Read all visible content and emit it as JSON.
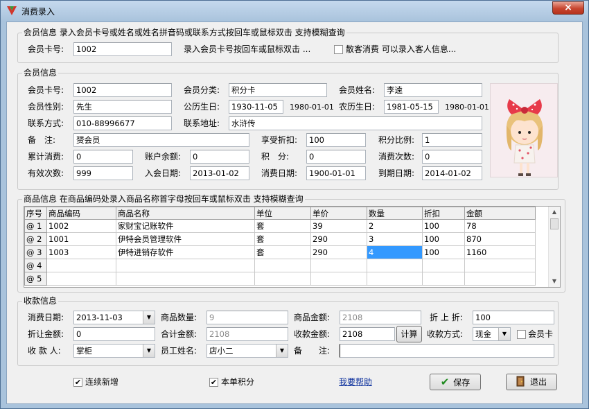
{
  "window": {
    "title": "消费录入",
    "close_glyph": "×"
  },
  "member_search": {
    "group_title": "会员信息 录入会员卡号或姓名或姓名拼音码或联系方式按回车或鼠标双击 支持模糊查询",
    "card_label": "会员卡号:",
    "card_value": "1002",
    "hint": "录入会员卡号按回车或鼠标双击 ...",
    "guest_checkbox_label": "散客消费 可以录入客人信息...",
    "guest_checked": false
  },
  "member_info": {
    "group_title": "会员信息",
    "card_no": {
      "label": "会员卡号:",
      "value": "1002"
    },
    "category": {
      "label": "会员分类:",
      "value": "积分卡"
    },
    "name": {
      "label": "会员姓名:",
      "value": "李逵"
    },
    "gender": {
      "label": "会员性别:",
      "value": "先生"
    },
    "solar_birthday": {
      "label": "公历生日:",
      "value": "1930-11-05",
      "extra": "1980-01-01"
    },
    "lunar_birthday": {
      "label": "农历生日:",
      "value": "1981-05-15",
      "extra": "1980-01-01"
    },
    "contact": {
      "label": "联系方式:",
      "value": "010-88996677"
    },
    "address": {
      "label": "联系地址:",
      "value": "水浒传"
    },
    "remark": {
      "label": "备　注:",
      "value": "赟会员"
    },
    "discount": {
      "label": "享受折扣:",
      "value": "100"
    },
    "points_ratio": {
      "label": "积分比例:",
      "value": "1"
    },
    "total_spent": {
      "label": "累计消费:",
      "value": "0"
    },
    "balance": {
      "label": "账户余额:",
      "value": "0"
    },
    "points": {
      "label": "积　分:",
      "value": "0"
    },
    "visits": {
      "label": "消费次数:",
      "value": "0"
    },
    "valid_times": {
      "label": "有效次数:",
      "value": "999"
    },
    "join_date": {
      "label": "入会日期:",
      "value": "2013-01-02"
    },
    "last_consume": {
      "label": "消费日期:",
      "value": "1900-01-01"
    },
    "expire_date": {
      "label": "到期日期:",
      "value": "2014-01-02"
    }
  },
  "goods": {
    "group_title": "商品信息 在商品编码处录入商品名称首字母按回车或鼠标双击 支持模糊查询",
    "columns": [
      "序号",
      "商品编码",
      "商品名称",
      "单位",
      "单价",
      "数量",
      "折扣",
      "金额"
    ],
    "rows": [
      {
        "no": "@ 1",
        "code": "1002",
        "name": "家财宝记账软件",
        "unit": "套",
        "price": "39",
        "qty": "2",
        "discount": "100",
        "amount": "78"
      },
      {
        "no": "@ 2",
        "code": "1001",
        "name": "伊特会员管理软件",
        "unit": "套",
        "price": "290",
        "qty": "3",
        "discount": "100",
        "amount": "870"
      },
      {
        "no": "@ 3",
        "code": "1003",
        "name": "伊特进销存软件",
        "unit": "套",
        "price": "290",
        "qty": "4",
        "discount": "100",
        "amount": "1160"
      },
      {
        "no": "@ 4",
        "code": "",
        "name": "",
        "unit": "",
        "price": "",
        "qty": "",
        "discount": "",
        "amount": ""
      },
      {
        "no": "@ 5",
        "code": "",
        "name": "",
        "unit": "",
        "price": "",
        "qty": "",
        "discount": "",
        "amount": ""
      }
    ]
  },
  "payment": {
    "group_title": "收款信息",
    "date": {
      "label": "消费日期:",
      "value": "2013-11-03"
    },
    "goods_qty": {
      "label": "商品数量:",
      "value": "9"
    },
    "goods_amount": {
      "label": "商品金额:",
      "value": "2108"
    },
    "extra_discount": {
      "label": "折 上 折:",
      "value": "100"
    },
    "discount_amount": {
      "label": "折让金额:",
      "value": "0"
    },
    "total_amount": {
      "label": "合计金额:",
      "value": "2108"
    },
    "received": {
      "label": "收款金额:",
      "value": "2108"
    },
    "calc_button": "计算",
    "method": {
      "label": "收款方式:",
      "value": "现金"
    },
    "member_card_checkbox": "会员卡",
    "payee": {
      "label": "收 款 人:",
      "value": "掌柜"
    },
    "staff": {
      "label": "员工姓名:",
      "value": "店小二"
    },
    "note": {
      "label": "备　　注:",
      "value": ""
    }
  },
  "footer": {
    "continuous_add": "连续新增",
    "earn_points": "本单积分",
    "help_link": "我要帮助",
    "save_button": "保存",
    "exit_button": "退出",
    "check_glyph": "✔"
  },
  "colors": {
    "titlebar": "#a9c3dc",
    "highlight": "#3399ff",
    "close": "#c7452f",
    "save_check": "#1e8a1e",
    "link": "#0b2f9c"
  }
}
